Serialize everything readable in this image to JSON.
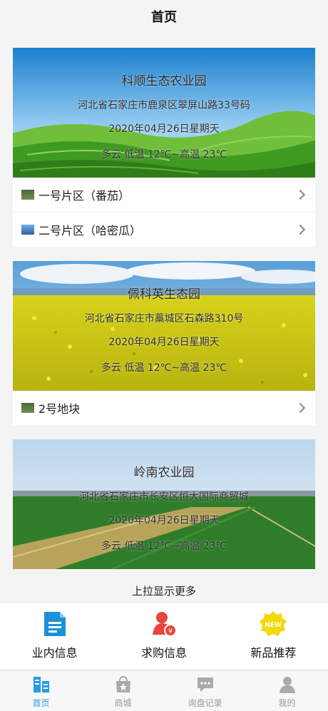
{
  "header": {
    "title": "首页"
  },
  "farms": [
    {
      "name": "科顺生态农业园",
      "address": "河北省石家庄市鹿泉区翠屏山路33号码",
      "date": "2020年04月26日星期天",
      "weather": "多云  低温 12℃~高温 23℃",
      "zones": [
        {
          "label": "一号片区（番茄）"
        },
        {
          "label": "二号片区（哈密瓜）"
        }
      ]
    },
    {
      "name": "佩科英生态园",
      "address": "河北省石家庄市藁城区石森路310号",
      "date": "2020年04月26日星期天",
      "weather": "多云  低温 12℃~高温 23℃",
      "zones": [
        {
          "label": "2号地块"
        }
      ]
    },
    {
      "name": "岭南农业园",
      "address": "河北省石家庄市长安区恒大国际商贸城",
      "date": "2020年04月26日星期天",
      "weather": "多云  低温 12℃~高温 23℃"
    }
  ],
  "load_more": "上拉显示更多",
  "quick_links": [
    {
      "label": "业内信息",
      "icon": "document-icon",
      "color": "#1e90d6"
    },
    {
      "label": "求购信息",
      "icon": "buyer-icon",
      "color": "#e8453c"
    },
    {
      "label": "新品推荐",
      "icon": "new-badge-icon",
      "color": "#f5d90a"
    }
  ],
  "tabs": [
    {
      "label": "首页",
      "icon": "home-icon",
      "active": true
    },
    {
      "label": "商城",
      "icon": "shop-icon",
      "active": false
    },
    {
      "label": "询盘记录",
      "icon": "chat-icon",
      "active": false
    },
    {
      "label": "我的",
      "icon": "user-icon",
      "active": false
    }
  ],
  "colors": {
    "accent": "#2a9ae3",
    "background": "#f4f4f4"
  }
}
